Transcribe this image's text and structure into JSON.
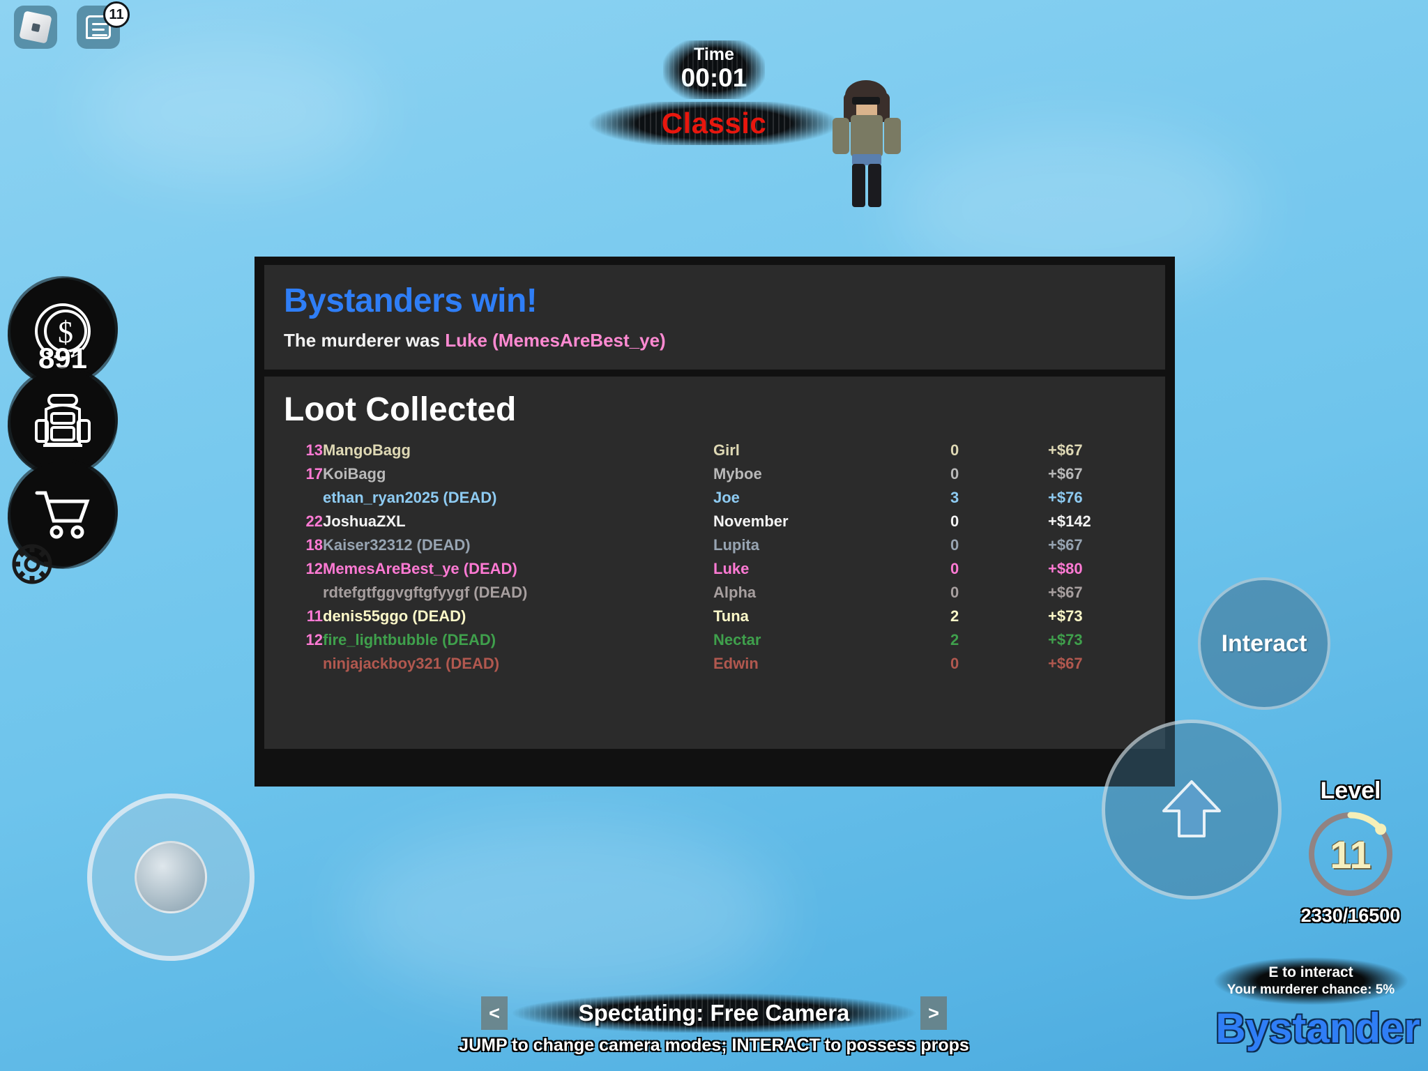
{
  "topbar": {
    "roblox_logo_icon": "roblox-logo-icon",
    "chat_icon": "chat-icon",
    "chat_badge": "11"
  },
  "timer": {
    "label": "Time",
    "value": "00:01",
    "mode": "Classic",
    "mode_color": "#e8170e"
  },
  "hud_left": {
    "coins_icon": "coin-dollar-icon",
    "coins": "891",
    "backpack_icon": "backpack-icon",
    "shop_icon": "shopping-cart-icon",
    "settings_icon": "gear-icon"
  },
  "results": {
    "win_title": "Bystanders win!",
    "win_color": "#2f7ef6",
    "murderer_label": "The murderer was",
    "murderer_name": "Luke (MemesAreBest_ye)",
    "murderer_color": "#ff8ad2",
    "loot_title": "Loot Collected",
    "rows": [
      {
        "num": "13",
        "player": "MangoBagg",
        "character": "Girl",
        "kills": "0",
        "cash": "+$67",
        "color": "#ded8b4"
      },
      {
        "num": "17",
        "player": "KoiBagg",
        "character": "Myboe",
        "kills": "0",
        "cash": "+$67",
        "color": "#b9b9b9"
      },
      {
        "num": "",
        "player": "ethan_ryan2025 (DEAD)",
        "character": "Joe",
        "kills": "3",
        "cash": "+$76",
        "color": "#8ecbf2"
      },
      {
        "num": "22",
        "player": "JoshuaZXL",
        "character": "November",
        "kills": "0",
        "cash": "+$142",
        "color": "#f4f4f4"
      },
      {
        "num": "18",
        "player": "Kaiser32312 (DEAD)",
        "character": "Lupita",
        "kills": "0",
        "cash": "+$67",
        "color": "#97a4b2"
      },
      {
        "num": "12",
        "player": "MemesAreBest_ye (DEAD)",
        "character": "Luke",
        "kills": "0",
        "cash": "+$80",
        "color": "#ff7ad4"
      },
      {
        "num": "",
        "player": "rdtefgtfggvgftgfyygf (DEAD)",
        "character": "Alpha",
        "kills": "0",
        "cash": "+$67",
        "color": "#a79f9f"
      },
      {
        "num": "11",
        "player": "denis55ggo (DEAD)",
        "character": "Tuna",
        "kills": "2",
        "cash": "+$73",
        "color": "#fcf8c8"
      },
      {
        "num": "12",
        "player": "fire_lightbubble (DEAD)",
        "character": "Nectar",
        "kills": "2",
        "cash": "+$73",
        "color": "#3fa04c"
      },
      {
        "num": "",
        "player": "ninjajackboy321 (DEAD)",
        "character": "Edwin",
        "kills": "0",
        "cash": "+$67",
        "color": "#b1584f"
      }
    ]
  },
  "controls": {
    "interact_label": "Interact",
    "jump_icon": "jump-arrow-icon",
    "joystick_icon": "movement-joystick"
  },
  "level": {
    "label": "Level",
    "value": "11",
    "xp": "2330/16500",
    "progress_percent": 14
  },
  "hints": {
    "interact": "E to interact",
    "murderer_chance": "Your murderer chance: 5%",
    "role": "Bystander",
    "role_color": "#2f7ef6"
  },
  "spectate": {
    "prev": "<",
    "next": ">",
    "text": "Spectating: Free Camera",
    "hint": "JUMP to change camera modes; INTERACT to possess props"
  }
}
